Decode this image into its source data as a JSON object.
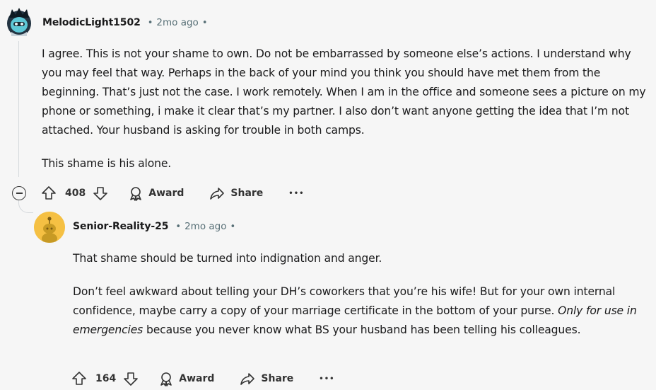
{
  "comments": [
    {
      "author": "MelodicLight1502",
      "dot_before": "•",
      "time": "2mo ago",
      "dot_after": "•",
      "paragraphs": [
        "I agree. This is not your shame to own. Do not be embarrassed by someone else’s actions. I understand why you may feel that way. Perhaps in the back of your mind you think you should have met them from the beginning. That’s just not the case. I work remotely. When I am in the office and someone sees a picture on my phone or something, i make it clear that’s my partner. I also don’t want anyone getting the idea that I’m not attached. Your husband is asking for trouble in both camps.",
        "This shame is his alone."
      ],
      "votes": "408",
      "award_label": "Award",
      "share_label": "Share",
      "more_label": "•••",
      "avatar_color": "#2d3e4a"
    },
    {
      "author": "Senior-Reality-25",
      "dot_before": "•",
      "time": "2mo ago",
      "dot_after": "•",
      "paragraph1": "That shame should be turned into indignation and anger.",
      "paragraph2_main": "Don’t feel awkward about telling your DH’s coworkers that you’re his wife! But for your own internal confidence, maybe carry a copy of your marriage certificate in the bottom of your purse. ",
      "paragraph2_italic": "Only for use in emergencies",
      "paragraph2_tail": " because you never know what BS your husband has been telling his colleagues.",
      "votes": "164",
      "award_label": "Award",
      "share_label": "Share",
      "more_label": "•••",
      "avatar_color": "#f5c043"
    }
  ]
}
